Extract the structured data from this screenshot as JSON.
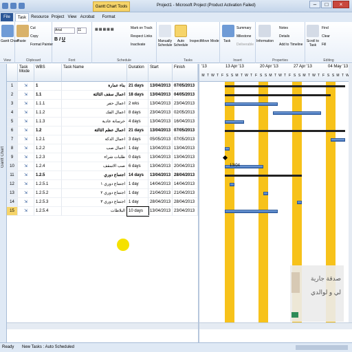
{
  "window": {
    "title": "Project1 - Microsoft Project (Product Activation Failed)",
    "context_tab": "Gantt Chart Tools",
    "context_subtab": "Format"
  },
  "ribbon_tabs": [
    "File",
    "Task",
    "Resource",
    "Project",
    "View",
    "Acrobat"
  ],
  "ribbon": {
    "view": {
      "gantt_chart": "Gantt Chart",
      "label": "View"
    },
    "clipboard": {
      "paste": "Paste",
      "cut": "Cut",
      "copy": "Copy",
      "format_painter": "Format Painter",
      "label": "Clipboard"
    },
    "font": {
      "family": "Arial",
      "size": "11",
      "label": "Font"
    },
    "schedule": {
      "mark_on_track": "Mark on Track",
      "respect_links": "Respect Links",
      "inactivate": "Inactivate",
      "label": "Schedule"
    },
    "tasks": {
      "manually_schedule": "Manually Schedule",
      "auto_schedule": "Auto Schedule",
      "inspect": "Inspect",
      "move": "Move",
      "mode": "Mode",
      "label": "Tasks"
    },
    "insert": {
      "task": "Task",
      "summary": "Summary",
      "milestone": "Milestone",
      "deliverable": "Deliverable",
      "label": "Insert"
    },
    "properties": {
      "information": "Information",
      "notes": "Notes",
      "details": "Details",
      "add_to_timeline": "Add to Timeline",
      "label": "Properties"
    },
    "editing": {
      "scroll_to_task": "Scroll to Task",
      "find": "Find",
      "clear": "Clear",
      "fill": "Fill",
      "label": "Editing"
    }
  },
  "left_bar_label": "Gantt Chart",
  "table": {
    "headers": {
      "mode": "Task Mode",
      "wbs": "WBS",
      "name": "Task Name",
      "duration": "Duration",
      "start": "Start",
      "finish": "Finish"
    },
    "rows": [
      {
        "id": "1",
        "wbs": "1",
        "name": "بناء عمارة",
        "duration": "21 days",
        "start": "13/04/2013",
        "finish": "07/05/2013",
        "bold": true
      },
      {
        "id": "2",
        "wbs": "1.1",
        "name": "اعمال سقف الثالثة",
        "duration": "18 days",
        "start": "13/04/2013",
        "finish": "04/05/2013",
        "bold": true
      },
      {
        "id": "3",
        "wbs": "1.1.1",
        "name": "اعمال حفر",
        "duration": "2 wks",
        "start": "13/04/2013",
        "finish": "23/04/2013"
      },
      {
        "id": "4",
        "wbs": "1.1.2",
        "name": "اعمال الفك",
        "duration": "8 days",
        "start": "23/04/2013",
        "finish": "02/05/2013"
      },
      {
        "id": "5",
        "wbs": "1.1.3",
        "name": "خرسانة عادية",
        "duration": "4 days",
        "start": "13/04/2013",
        "finish": "16/04/2013"
      },
      {
        "id": "6",
        "wbs": "1.2",
        "name": "اعمال عظم الثالثة",
        "duration": "21 days",
        "start": "13/04/2013",
        "finish": "07/05/2013",
        "bold": true
      },
      {
        "id": "7",
        "wbs": "1.2.1",
        "name": "اعمال الدكة",
        "duration": "3 days",
        "start": "05/05/2013",
        "finish": "07/05/2013"
      },
      {
        "id": "8",
        "wbs": "1.2.2",
        "name": "اعمال صب",
        "duration": "1 day",
        "start": "13/04/2013",
        "finish": "13/04/2013"
      },
      {
        "id": "9",
        "wbs": "1.2.3",
        "name": "طلبات شراء",
        "duration": "0 days",
        "start": "13/04/2013",
        "finish": "13/04/2013"
      },
      {
        "id": "10",
        "wbs": "1.2.4",
        "name": "صب الاسقف",
        "duration": "6 days",
        "start": "13/04/2013",
        "finish": "20/04/2013"
      },
      {
        "id": "11",
        "wbs": "1.2.5",
        "name": "اجتماع دوري",
        "duration": "14 days",
        "start": "13/04/2013",
        "finish": "28/04/2013",
        "bold": true
      },
      {
        "id": "12",
        "wbs": "1.2.5.1",
        "name": "اجتماع دوري ١",
        "duration": "1 day",
        "start": "14/04/2013",
        "finish": "14/04/2013"
      },
      {
        "id": "13",
        "wbs": "1.2.5.2",
        "name": "اجتماع دوري ٢",
        "duration": "1 day",
        "start": "21/04/2013",
        "finish": "21/04/2013"
      },
      {
        "id": "14",
        "wbs": "1.2.5.3",
        "name": "اجتماع دوري ٣",
        "duration": "1 day",
        "start": "28/04/2013",
        "finish": "28/04/2013"
      },
      {
        "id": "15",
        "wbs": "1.2.5.4",
        "name": "البلاطات",
        "duration": "10 days",
        "start": "13/04/2013",
        "finish": "23/04/2013"
      }
    ]
  },
  "gantt": {
    "weeks": [
      "'13",
      "13 Apr '13",
      "20 Apr '13",
      "27 Apr '13",
      "04 May '13"
    ],
    "day_letters": [
      "M",
      "T",
      "W",
      "T",
      "F",
      "S",
      "S",
      "M",
      "T",
      "W",
      "T",
      "F",
      "S",
      "S",
      "M",
      "T",
      "W",
      "T",
      "F",
      "S",
      "S",
      "M",
      "T",
      "W",
      "T",
      "F",
      "S",
      "S",
      "M",
      "T",
      "W"
    ],
    "milestone_label": "13/04"
  },
  "watermark": {
    "line1": "صدقة جارية",
    "line2": "لي و لوالدي"
  },
  "status": {
    "ready": "Ready",
    "new_tasks": "New Tasks : Auto Scheduled"
  }
}
